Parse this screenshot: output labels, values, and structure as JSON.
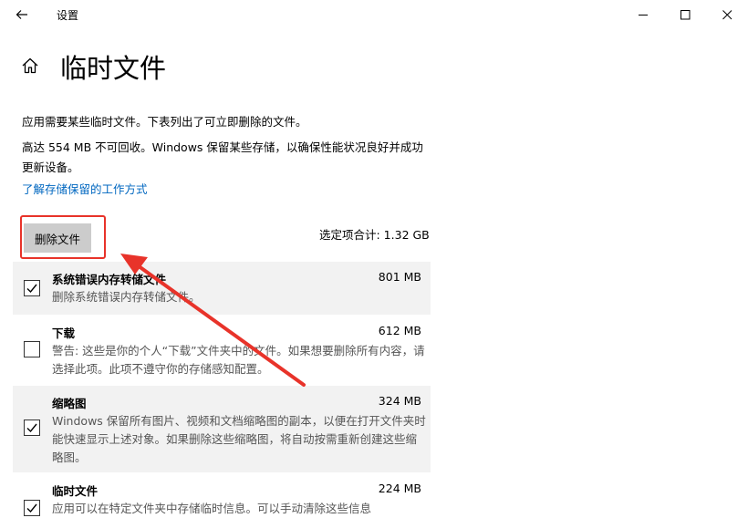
{
  "window": {
    "title": "设置"
  },
  "page": {
    "title": "临时文件",
    "description": "应用需要某些临时文件。下表列出了可立即删除的文件。",
    "reserved_note": "高达 554 MB 不可回收。Windows 保留某些存储，以确保性能状况良好并成功更新设备。",
    "learn_link": "了解存储保留的工作方式",
    "delete_button": "删除文件",
    "total_selected": "选定项合计: 1.32 GB"
  },
  "items": [
    {
      "title": "系统错误内存转储文件",
      "size": "801 MB",
      "description": "删除系统错误内存转储文件。",
      "checked": true
    },
    {
      "title": "下载",
      "size": "612 MB",
      "description": "警告: 这些是你的个人“下载”文件夹中的文件。如果想要删除所有内容，请选择此项。此项不遵守你的存储感知配置。",
      "checked": false
    },
    {
      "title": "缩略图",
      "size": "324 MB",
      "description": "Windows 保留所有图片、视频和文档缩略图的副本，以便在打开文件夹时能快速显示上述对象。如果删除这些缩略图，将自动按需重新创建这些缩略图。",
      "checked": true
    },
    {
      "title": "临时文件",
      "size": "224 MB",
      "description": "应用可以在特定文件夹中存储临时信息。可以手动清除这些信息",
      "checked": true
    }
  ],
  "annotation": {
    "highlight_color": "#e8332a"
  },
  "colors": {
    "link": "#0067c0",
    "checked_row_bg": "#f2f2f2",
    "button_bg": "#cccccc"
  }
}
